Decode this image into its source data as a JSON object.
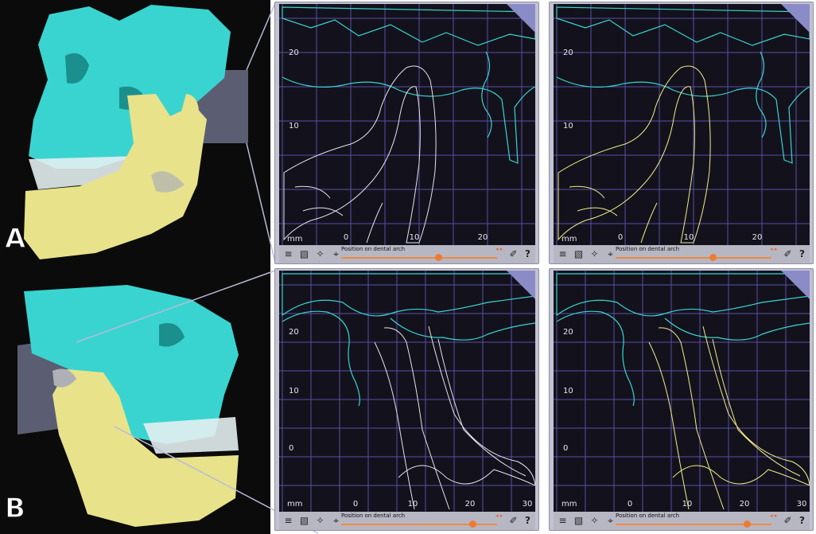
{
  "figure": {
    "labels": [
      "A",
      "B"
    ]
  },
  "colors": {
    "maxilla": "#39d4d0",
    "mandible": "#e8e28a",
    "bone_contour_grey": "#e4e4ea",
    "bone_contour_yellow": "#f1ee88",
    "grid": "#5a4fa6",
    "panel_background": "#13121c",
    "slider": "#ef8a3e"
  },
  "panels": [
    {
      "id": "A-left",
      "unit_label": "mm",
      "x_ticks": [
        "0",
        "10",
        "20"
      ],
      "y_ticks": [
        "20",
        "10"
      ],
      "contour_color": "grey",
      "slider_label": "Position on dental arch",
      "slider_value": 0.62,
      "arrow_glyphs": "◂ ▸",
      "help_label": "?",
      "icons": [
        "sliders-icon",
        "slab-icon",
        "wand-icon",
        "crosshair-icon",
        "brush-icon"
      ]
    },
    {
      "id": "A-right",
      "unit_label": "mm",
      "x_ticks": [
        "0",
        "10",
        "20"
      ],
      "y_ticks": [
        "20",
        "10"
      ],
      "contour_color": "yellow",
      "slider_label": "Position on dental arch",
      "slider_value": 0.62,
      "arrow_glyphs": "◂ ▸",
      "help_label": "?",
      "icons": [
        "sliders-icon",
        "slab-icon",
        "wand-icon",
        "crosshair-icon",
        "brush-icon"
      ]
    },
    {
      "id": "B-left",
      "unit_label": "mm",
      "x_ticks": [
        "0",
        "10",
        "20",
        "30"
      ],
      "y_ticks": [
        "20",
        "10",
        "0"
      ],
      "contour_color": "grey",
      "slider_label": "Position on dental arch",
      "slider_value": 0.84,
      "arrow_glyphs": "◂ ▸",
      "help_label": "?",
      "icons": [
        "sliders-icon",
        "slab-icon",
        "wand-icon",
        "crosshair-icon",
        "brush-icon"
      ]
    },
    {
      "id": "B-right",
      "unit_label": "mm",
      "x_ticks": [
        "0",
        "10",
        "20",
        "30"
      ],
      "y_ticks": [
        "20",
        "10",
        "0"
      ],
      "contour_color": "yellow",
      "slider_label": "Position on dental arch",
      "slider_value": 0.84,
      "arrow_glyphs": "◂ ▸",
      "help_label": "?",
      "icons": [
        "sliders-icon",
        "slab-icon",
        "wand-icon",
        "crosshair-icon",
        "brush-icon"
      ]
    }
  ]
}
